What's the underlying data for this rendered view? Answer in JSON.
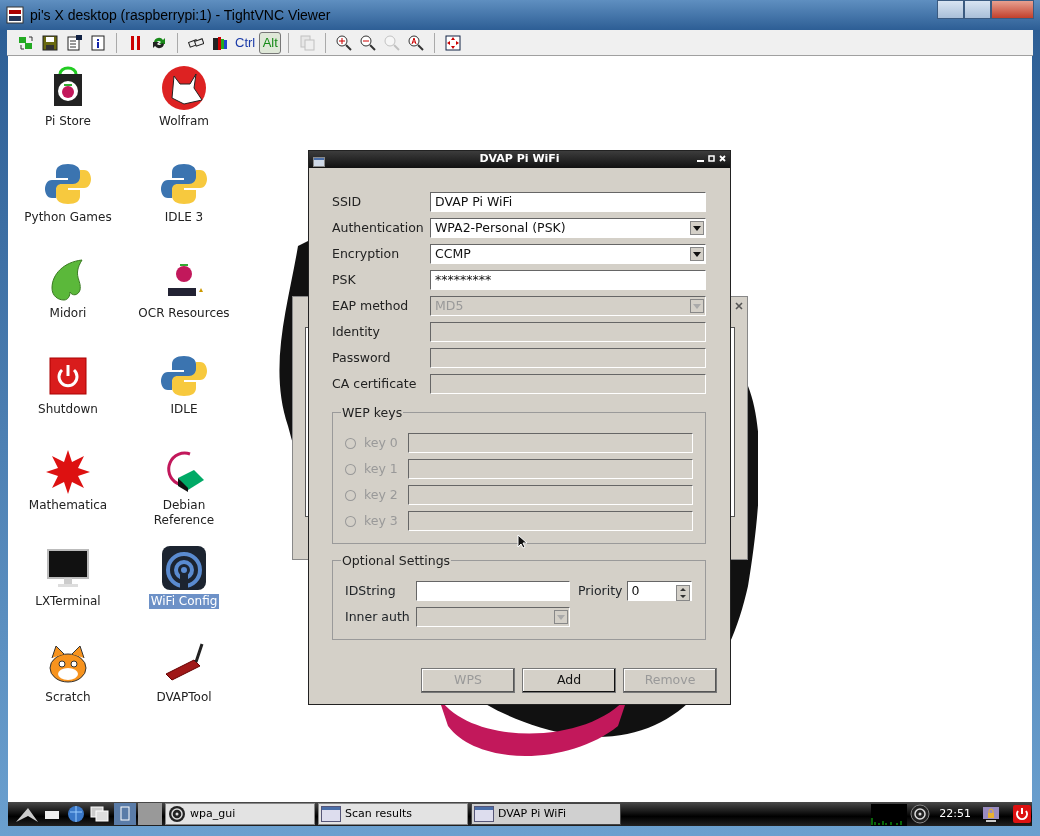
{
  "window": {
    "title": "pi's X desktop (raspberrypi:1) - TightVNC Viewer"
  },
  "toolbar": [
    {
      "kind": "icon",
      "pressed": false,
      "disabled": false
    },
    {
      "kind": "icon",
      "pressed": false,
      "disabled": false
    },
    {
      "kind": "icon",
      "pressed": false,
      "disabled": false
    },
    {
      "kind": "icon",
      "pressed": false,
      "disabled": false
    },
    {
      "kind": "separator"
    },
    {
      "kind": "icon",
      "pressed": false,
      "disabled": false
    },
    {
      "kind": "icon",
      "pressed": false,
      "disabled": false
    },
    {
      "kind": "separator"
    },
    {
      "kind": "icon",
      "pressed": false,
      "disabled": false
    },
    {
      "kind": "icon",
      "pressed": false,
      "disabled": false
    },
    {
      "kind": "text",
      "text": "Ctrl",
      "pressed": false,
      "disabled": false
    },
    {
      "kind": "text",
      "text": "Alt",
      "pressed": true,
      "disabled": false
    },
    {
      "kind": "separator"
    },
    {
      "kind": "icon",
      "pressed": false,
      "disabled": true
    },
    {
      "kind": "separator"
    },
    {
      "kind": "icon",
      "pressed": false,
      "disabled": false
    },
    {
      "kind": "icon",
      "pressed": false,
      "disabled": false
    },
    {
      "kind": "icon",
      "pressed": false,
      "disabled": true
    },
    {
      "kind": "icon",
      "pressed": false,
      "disabled": false
    },
    {
      "kind": "separator"
    },
    {
      "kind": "icon",
      "pressed": false,
      "disabled": false
    }
  ],
  "desktop_icons": [
    {
      "label": "Pi Store",
      "selected": false
    },
    {
      "label": "Wolfram",
      "selected": false
    },
    {
      "label": "Python Games",
      "selected": false
    },
    {
      "label": "IDLE 3",
      "selected": false
    },
    {
      "label": "Midori",
      "selected": false
    },
    {
      "label": "OCR Resources",
      "selected": false
    },
    {
      "label": "Shutdown",
      "selected": false
    },
    {
      "label": "IDLE",
      "selected": false
    },
    {
      "label": "Mathematica",
      "selected": false
    },
    {
      "label": "Debian Reference",
      "selected": false
    },
    {
      "label": "LXTerminal",
      "selected": false
    },
    {
      "label": "WiFi Config",
      "selected": true
    },
    {
      "label": "Scratch",
      "selected": false
    },
    {
      "label": "DVAPTool",
      "selected": false
    }
  ],
  "dialog": {
    "title": "DVAP Pi WiFi",
    "fields": [
      {
        "label": "SSID",
        "kind": "text",
        "value": "DVAP Pi WiFi",
        "disabled": false
      },
      {
        "label": "Authentication",
        "kind": "combo",
        "value": "WPA2-Personal (PSK)",
        "disabled": false
      },
      {
        "label": "Encryption",
        "kind": "combo",
        "value": "CCMP",
        "disabled": false
      },
      {
        "label": "PSK",
        "kind": "text",
        "value": "*********",
        "disabled": false
      },
      {
        "label": "EAP method",
        "kind": "combo",
        "value": "MD5",
        "disabled": true
      },
      {
        "label": "Identity",
        "kind": "text",
        "disabled": true
      },
      {
        "label": "Password",
        "kind": "text",
        "disabled": true
      },
      {
        "label": "CA certificate",
        "kind": "text",
        "disabled": true
      }
    ],
    "wep_keys": {
      "title": "WEP keys",
      "keys": [
        {
          "label": "key 0",
          "selected": false,
          "disabled": true
        },
        {
          "label": "key 1",
          "selected": false,
          "disabled": true
        },
        {
          "label": "key 2",
          "selected": false,
          "disabled": true
        },
        {
          "label": "key 3",
          "selected": false,
          "disabled": true
        }
      ]
    },
    "optional_settings": {
      "title": "Optional Settings",
      "idstring": {
        "label": "IDString"
      },
      "priority": {
        "label": "Priority",
        "value": "0"
      },
      "inner_auth": {
        "label": "Inner auth",
        "disabled": true
      }
    },
    "buttons": [
      {
        "label": "WPS",
        "disabled": true
      },
      {
        "label": "Add",
        "disabled": false
      },
      {
        "label": "Remove",
        "disabled": true
      }
    ]
  },
  "taskbar": {
    "tasks": [
      {
        "label": "wpa_gui",
        "selected": false
      },
      {
        "label": "Scan results",
        "selected": false
      },
      {
        "label": "DVAP Pi WiFi",
        "selected": true
      }
    ],
    "clock": "22:51"
  }
}
